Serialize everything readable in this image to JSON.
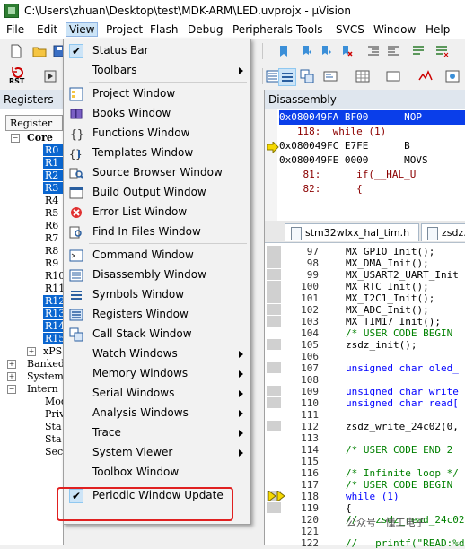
{
  "window": {
    "title": "C:\\Users\\zhuan\\Desktop\\test\\MDK-ARM\\LED.uvprojx - µVision"
  },
  "menubar": [
    "File",
    "Edit",
    "View",
    "Project",
    "Flash",
    "Debug",
    "Peripherals",
    "Tools",
    "SVCS",
    "Window",
    "Help"
  ],
  "toolbar": {
    "rst_label": "RST"
  },
  "registers": {
    "title": "Registers",
    "header": "Register",
    "core_label": "Core",
    "regs": [
      "R0",
      "R1",
      "R2",
      "R3",
      "R4",
      "R5",
      "R6",
      "R7",
      "R8",
      "R9",
      "R10",
      "R11",
      "R12",
      "R13",
      "R14",
      "R15"
    ],
    "highlighted": [
      "R0",
      "R1",
      "R2",
      "R3",
      "R12",
      "R13",
      "R14",
      "R15"
    ],
    "other_rows": [
      "xPS",
      "Banked",
      "System",
      "Intern",
      "Mod",
      "Priv",
      "Sta",
      "Sta",
      "Sec"
    ]
  },
  "disassembly": {
    "title": "Disassembly",
    "lines": [
      "0x080049FA BF00      NOP",
      "   118:  while (1)",
      "0x080049FC E7FE      B",
      "0x080049FE 0000      MOVS",
      "    81:      if(__HAL_U",
      "    82:      {"
    ]
  },
  "editor": {
    "tabs": [
      "stm32wlxx_hal_tim.h",
      "zsdz."
    ],
    "lines": [
      {
        "n": "97",
        "code": "MX_GPIO_Init();"
      },
      {
        "n": "98",
        "code": "MX_DMA_Init();"
      },
      {
        "n": "99",
        "code": "MX_USART2_UART_Init"
      },
      {
        "n": "100",
        "code": "MX_RTC_Init();"
      },
      {
        "n": "101",
        "code": "MX_I2C1_Init();"
      },
      {
        "n": "102",
        "code": "MX_ADC_Init();"
      },
      {
        "n": "103",
        "code": "MX_TIM17_Init();"
      },
      {
        "n": "104",
        "code": "/* USER CODE BEGIN"
      },
      {
        "n": "105",
        "code": "zsdz_init();"
      },
      {
        "n": "106",
        "code": ""
      },
      {
        "n": "107",
        "code": "unsigned char oled_"
      },
      {
        "n": "108",
        "code": ""
      },
      {
        "n": "109",
        "code": "unsigned char write"
      },
      {
        "n": "110",
        "code": "unsigned char read["
      },
      {
        "n": "111",
        "code": ""
      },
      {
        "n": "112",
        "code": "zsdz_write_24c02(0,"
      },
      {
        "n": "113",
        "code": ""
      },
      {
        "n": "114",
        "code": "/* USER CODE END 2"
      },
      {
        "n": "115",
        "code": ""
      },
      {
        "n": "116",
        "code": "/* Infinite loop */"
      },
      {
        "n": "117",
        "code": "/* USER CODE BEGIN"
      },
      {
        "n": "118",
        "code": "while (1)"
      },
      {
        "n": "119",
        "code": "{"
      },
      {
        "n": "120",
        "code": "//   zsdz_read_24c02"
      },
      {
        "n": "121",
        "code": ""
      },
      {
        "n": "122",
        "code": "//   printf(\"READ:%d"
      }
    ]
  },
  "view_menu": {
    "items": [
      {
        "label": "Status Bar",
        "icon": "check-icon",
        "checked": true
      },
      {
        "label": "Toolbars",
        "submenu": true
      },
      {
        "sep": true
      },
      {
        "label": "Project Window",
        "icon": "project-window-icon"
      },
      {
        "label": "Books Window",
        "icon": "books-icon"
      },
      {
        "label": "Functions Window",
        "icon": "functions-icon"
      },
      {
        "label": "Templates Window",
        "icon": "templates-icon"
      },
      {
        "label": "Source Browser Window",
        "icon": "source-browser-icon"
      },
      {
        "label": "Build Output Window",
        "icon": "build-output-icon"
      },
      {
        "label": "Error List Window",
        "icon": "error-list-icon"
      },
      {
        "label": "Find In Files Window",
        "icon": "find-in-files-icon"
      },
      {
        "sep": true
      },
      {
        "label": "Command Window",
        "icon": "command-window-icon"
      },
      {
        "label": "Disassembly Window",
        "icon": "disassembly-icon"
      },
      {
        "label": "Symbols Window",
        "icon": "symbols-icon"
      },
      {
        "label": "Registers Window",
        "icon": "registers-icon"
      },
      {
        "label": "Call Stack Window",
        "icon": "call-stack-icon"
      },
      {
        "label": "Watch Windows",
        "submenu": true
      },
      {
        "label": "Memory Windows",
        "submenu": true
      },
      {
        "label": "Serial Windows",
        "submenu": true
      },
      {
        "label": "Analysis Windows",
        "submenu": true
      },
      {
        "label": "Trace",
        "submenu": true
      },
      {
        "label": "System Viewer",
        "submenu": true
      },
      {
        "label": "Toolbox Window",
        "icon": "toolbox-icon"
      },
      {
        "sep": true
      },
      {
        "label": "Periodic Window Update",
        "icon": "check-icon",
        "checked": true
      }
    ]
  },
  "watermark": "公众号 · 懂工电子"
}
